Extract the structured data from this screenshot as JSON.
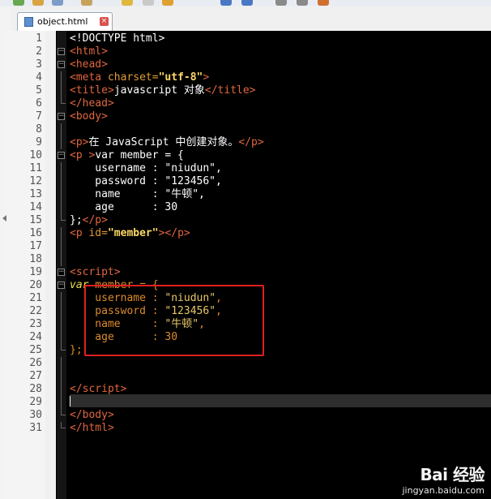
{
  "tab": {
    "label": "object.html",
    "close_glyph": "×"
  },
  "colors": {
    "red_box": "#e02020",
    "tag": "#e0673e",
    "string": "#e8c867",
    "keyword": "#f0e04a",
    "js_text": "#dc8a2c"
  },
  "lines": [
    {
      "n": "1",
      "html": "<span class=\"txt\">&lt;!DOCTYPE html&gt;</span>"
    },
    {
      "n": "2",
      "fold": "open",
      "html": "<span class=\"tag\">&lt;html&gt;</span>"
    },
    {
      "n": "3",
      "fold": "open",
      "html": "<span class=\"tag\">&lt;head&gt;</span>"
    },
    {
      "n": "4",
      "html": "<span class=\"tag\">&lt;meta </span><span class=\"attr\">charset=</span><span class=\"strb\">\"utf-8\"</span><span class=\"tag\">&gt;</span>"
    },
    {
      "n": "5",
      "html": "<span class=\"tag\">&lt;title&gt;</span><span class=\"txt\">javascript 对象</span><span class=\"tag\">&lt;/title&gt;</span>"
    },
    {
      "n": "6",
      "fold": "end",
      "html": "<span class=\"tag\">&lt;/head&gt;</span>"
    },
    {
      "n": "7",
      "fold": "open",
      "html": "<span class=\"tag\">&lt;body&gt;</span>"
    },
    {
      "n": "8",
      "html": ""
    },
    {
      "n": "9",
      "html": "<span class=\"tag\">&lt;p&gt;</span><span class=\"txt\">在 JavaScript 中创建对象。</span><span class=\"tag\">&lt;/p&gt;</span>"
    },
    {
      "n": "10",
      "fold": "open",
      "html": "<span class=\"tag\">&lt;p &gt;</span><span class=\"txt\">var member = {</span>"
    },
    {
      "n": "11",
      "html": "<span class=\"txt\">    username : \"niudun\",</span>"
    },
    {
      "n": "12",
      "html": "<span class=\"txt\">    password : \"123456\",</span>"
    },
    {
      "n": "13",
      "html": "<span class=\"txt\">    name     : \"牛顿\",</span>"
    },
    {
      "n": "14",
      "html": "<span class=\"txt\">    age      : 30</span>"
    },
    {
      "n": "15",
      "fold": "end",
      "html": "<span class=\"txt\">};</span><span class=\"tag\">&lt;/p&gt;</span>"
    },
    {
      "n": "16",
      "html": "<span class=\"tag\">&lt;p </span><span class=\"attr\">id=</span><span class=\"strb\">\"member\"</span><span class=\"tag\">&gt;&lt;/p&gt;</span>"
    },
    {
      "n": "17",
      "html": ""
    },
    {
      "n": "18",
      "html": ""
    },
    {
      "n": "19",
      "fold": "open",
      "html": "<span class=\"tag\">&lt;script&gt;</span>"
    },
    {
      "n": "20",
      "fold": "open",
      "html": "<span class=\"kw\">var</span><span class=\"js\"> member = {</span>"
    },
    {
      "n": "21",
      "html": "<span class=\"js\">    username : </span><span class=\"str\">\"niudun\"</span><span class=\"js\">,</span>"
    },
    {
      "n": "22",
      "html": "<span class=\"js\">    password : </span><span class=\"str\">\"123456\"</span><span class=\"js\">,</span>"
    },
    {
      "n": "23",
      "html": "<span class=\"js\">    name     : </span><span class=\"str\">\"牛顿\"</span><span class=\"js\">,</span>"
    },
    {
      "n": "24",
      "html": "<span class=\"js\">    age      : 30</span>"
    },
    {
      "n": "25",
      "fold": "end",
      "html": "<span class=\"js\">};</span>"
    },
    {
      "n": "26",
      "html": ""
    },
    {
      "n": "27",
      "html": ""
    },
    {
      "n": "28",
      "html": "<span class=\"tag\">&lt;/script&gt;</span>"
    },
    {
      "n": "29",
      "current": true,
      "html": ""
    },
    {
      "n": "30",
      "fold": "end",
      "html": "<span class=\"tag\">&lt;/body&gt;</span>"
    },
    {
      "n": "31",
      "fold": "end",
      "html": "<span class=\"tag\">&lt;/html&gt;</span>"
    }
  ],
  "watermark": {
    "logo": "Bai 经验",
    "sub": "jingyan.baidu.com"
  }
}
